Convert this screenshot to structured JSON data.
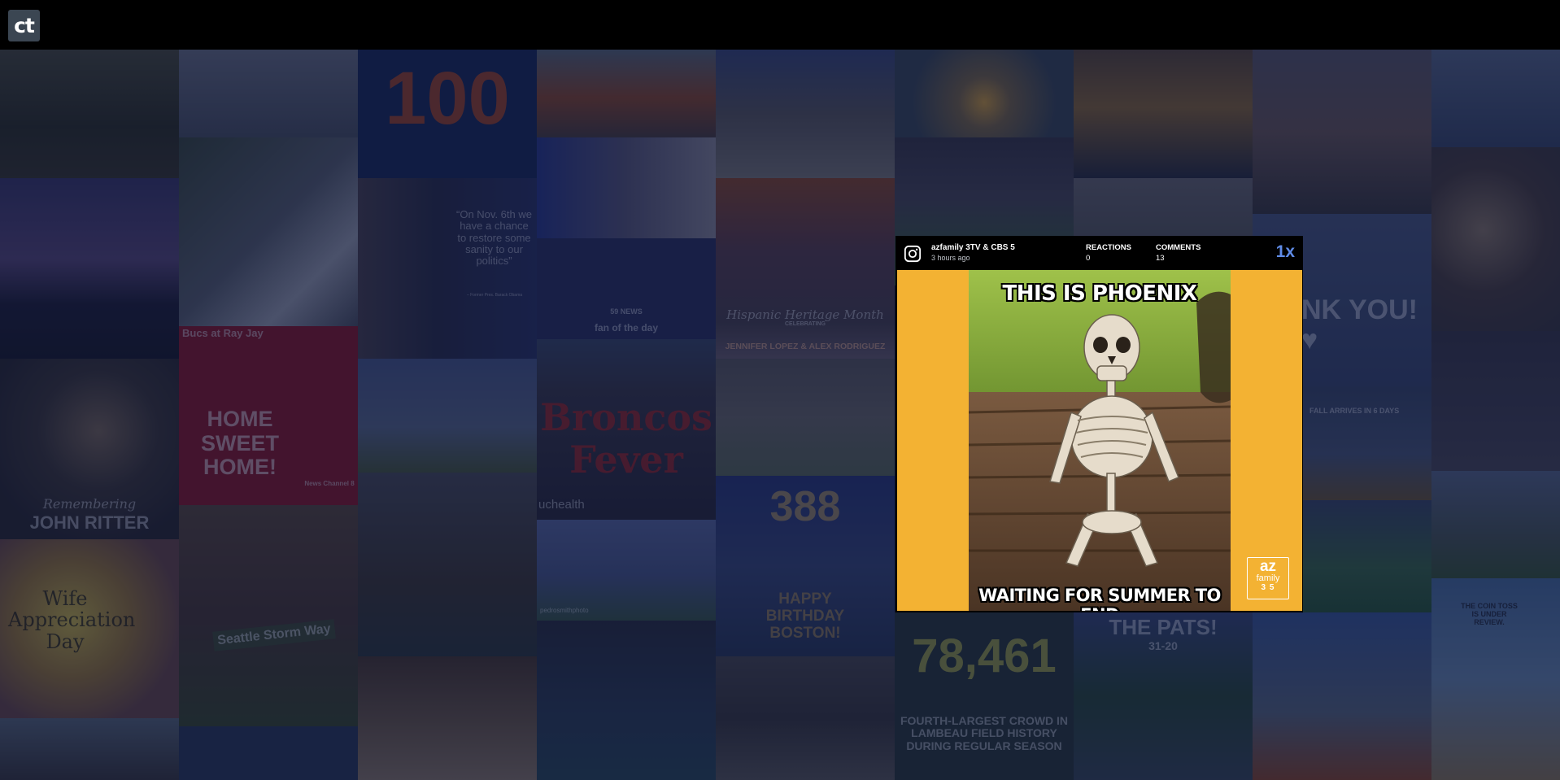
{
  "app": {
    "logo_text": "ct"
  },
  "post": {
    "author": "azfamily 3TV & CBS 5",
    "time": "3 hours ago",
    "reactions_label": "REACTIONS",
    "reactions_count": "0",
    "comments_label": "COMMENTS",
    "comments_count": "13",
    "playback_speed": "1x",
    "meme_top_text": "THIS IS PHOENIX",
    "meme_bottom_text": "WAITING FOR SUMMER TO END",
    "badge_line1": "az",
    "badge_line2": "family",
    "badge_line3": "3 5",
    "accent_color": "#f3b233",
    "icon": "instagram-icon"
  },
  "tiles": {
    "buccaneers_caption": "Bucs at Ray Jay",
    "buccaneers_text": "HOME SWEET HOME!",
    "obama_quote": "“On Nov. 6th we have a chance to restore some sanity to our politics”",
    "obama_attrib": "– Former Pres. Barack Obama",
    "ritter_script": "Remembering",
    "ritter_name": "JOHN RITTER",
    "wife_day": "Wife Appreciation Day",
    "storm_sign": "Seattle Storm Way",
    "broncos_fever": "Broncos Fever",
    "uchealth": "uchealth",
    "fan_of_day": "fan of the day",
    "news59": "59 NEWS",
    "hispanic_heritage": "Hispanic Heritage Month",
    "hispanic_celebrating": "CELEBRATING",
    "jlo_arod": "JENNIFER LOPEZ & ALEX RODRIGUEZ",
    "birthday_number": "388",
    "birthday_text": "HAPPY BIRTHDAY BOSTON!",
    "crowd_number": "78,461",
    "crowd_text": "FOURTH-LARGEST CROWD IN LAMBEAU FIELD HISTORY DURING REGULAR SEASON",
    "pats": "THE PATS!",
    "pats_score": "31-20",
    "thank_you": "NK YOU! ♥",
    "fall_arrives": "FALL ARRIVES IN 6 DAYS",
    "big100": "100",
    "comic_text": "THE COIN TOSS IS UNDER REVIEW.",
    "photo_credit": "pedrosmithphoto",
    "channel8": "News Channel 8"
  }
}
